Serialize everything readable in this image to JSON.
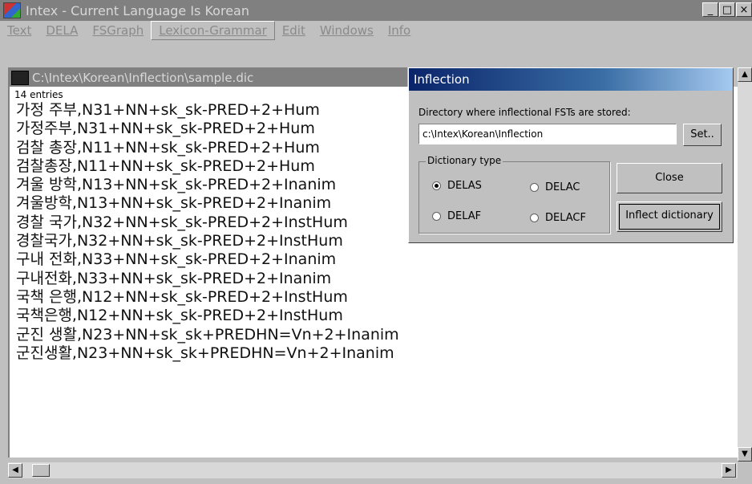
{
  "window": {
    "title": "Intex - Current Language Is Korean",
    "minimize": "_",
    "maximize": "□",
    "close": "×"
  },
  "menu": [
    {
      "label": "Text"
    },
    {
      "label": "DELA"
    },
    {
      "label": "FSGraph"
    },
    {
      "label": "Lexicon-Grammar"
    },
    {
      "label": "Edit"
    },
    {
      "label": "Windows"
    },
    {
      "label": "Info"
    }
  ],
  "document": {
    "title": "C:\\Intex\\Korean\\Inflection\\sample.dic",
    "entries_label": "14 entries",
    "lines": [
      "가정 주부,N31+NN+sk_sk-PRED+2+Hum",
      "가정주부,N31+NN+sk_sk-PRED+2+Hum",
      "검찰 총장,N11+NN+sk_sk-PRED+2+Hum",
      "검찰총장,N11+NN+sk_sk-PRED+2+Hum",
      "겨울 방학,N13+NN+sk_sk-PRED+2+Inanim",
      "겨울방학,N13+NN+sk_sk-PRED+2+Inanim",
      "경찰 국가,N32+NN+sk_sk-PRED+2+InstHum",
      "경찰국가,N32+NN+sk_sk-PRED+2+InstHum",
      "구내 전화,N33+NN+sk_sk-PRED+2+Inanim",
      "구내전화,N33+NN+sk_sk-PRED+2+Inanim",
      "국책 은행,N12+NN+sk_sk-PRED+2+InstHum",
      "국책은행,N12+NN+sk_sk-PRED+2+InstHum",
      "군진 생활,N23+NN+sk_sk+PREDHN=Vn+2+Inanim",
      "군진생활,N23+NN+sk_sk+PREDHN=Vn+2+Inanim"
    ]
  },
  "dialog": {
    "title": "Inflection",
    "dir_label": "Directory where inflectional FSTs are stored:",
    "dir_value": "c:\\Intex\\Korean\\Inflection",
    "set_button": "Set..",
    "group_label": "Dictionary type",
    "radios": [
      {
        "label": "DELAS",
        "checked": true
      },
      {
        "label": "DELAC",
        "checked": false
      },
      {
        "label": "DELAF",
        "checked": false
      },
      {
        "label": "DELACF",
        "checked": false
      }
    ],
    "close_button": "Close",
    "inflect_button": "Inflect dictionary"
  }
}
